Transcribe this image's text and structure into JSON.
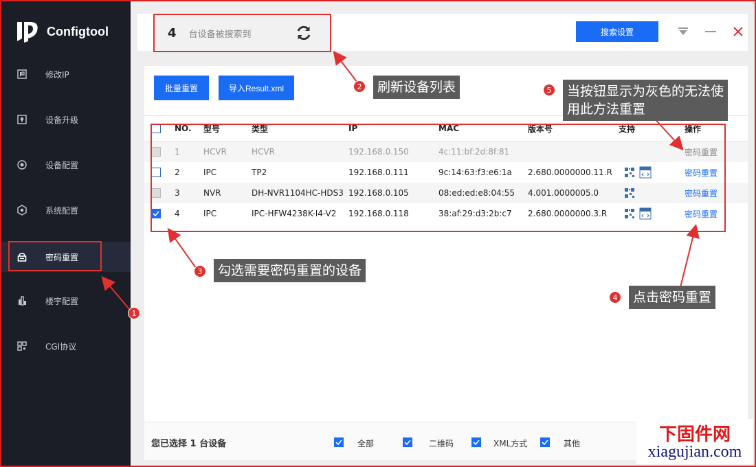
{
  "app": {
    "name": "Configtool"
  },
  "sidebar": {
    "items": [
      {
        "label": "修改IP",
        "icon": "ip-icon"
      },
      {
        "label": "设备升级",
        "icon": "upgrade-icon"
      },
      {
        "label": "设备配置",
        "icon": "config-icon"
      },
      {
        "label": "系统配置",
        "icon": "system-icon"
      },
      {
        "label": "密码重置",
        "icon": "lock-icon",
        "active": true
      },
      {
        "label": "楼宇配置",
        "icon": "building-icon"
      },
      {
        "label": "CGI协议",
        "icon": "cgi-icon"
      }
    ]
  },
  "topbar": {
    "device_count": "4",
    "device_count_label": "台设备被搜索到",
    "search_settings": "搜索设置"
  },
  "toolbar": {
    "batch_reset": "批量重置",
    "import_result": "导入Result.xml"
  },
  "table": {
    "headers": {
      "no": "NO.",
      "model": "型号",
      "type": "类型",
      "ip": "IP",
      "mac": "MAC",
      "version": "版本号",
      "support": "支持",
      "action": "操作"
    },
    "rows": [
      {
        "no": "1",
        "model": "HCVR",
        "type": "HCVR",
        "ip": "192.168.0.150",
        "mac": "4c:11:bf:2d:8f:81",
        "version": "",
        "action": "密码重置",
        "state": "disabled",
        "checked": false,
        "qr": false,
        "xml": false
      },
      {
        "no": "2",
        "model": "IPC",
        "type": "TP2",
        "ip": "192.168.0.111",
        "mac": "9c:14:63:f3:e6:1a",
        "version": "2.680.0000000.11.R",
        "action": "密码重置",
        "state": "normal",
        "checked": false,
        "qr": true,
        "xml": true
      },
      {
        "no": "3",
        "model": "NVR",
        "type": "DH-NVR1104HC-HDS3",
        "ip": "192.168.0.105",
        "mac": "08:ed:ed:e8:04:55",
        "version": "4.001.0000005.0",
        "action": "密码重置",
        "state": "normal",
        "checked": false,
        "qr": true,
        "xml": false
      },
      {
        "no": "4",
        "model": "IPC",
        "type": "IPC-HFW4238K-I4-V2",
        "ip": "192.168.0.118",
        "mac": "38:af:29:d3:2b:c7",
        "version": "2.680.0000000.3.R",
        "action": "密码重置",
        "state": "normal",
        "checked": true,
        "qr": true,
        "xml": true
      }
    ]
  },
  "footer": {
    "selected_prefix": "您已选择",
    "selected_count": "1",
    "selected_suffix": "台设备",
    "filters": [
      "全部",
      "二维码",
      "XML方式",
      "其他"
    ]
  },
  "annotations": [
    {
      "num": "1",
      "text": ""
    },
    {
      "num": "2",
      "text": "刷新设备列表"
    },
    {
      "num": "3",
      "text": "勾选需要密码重置的设备"
    },
    {
      "num": "4",
      "text": "点击密码重置"
    },
    {
      "num": "5",
      "text_line1": "当按钮显示为灰色的无法使",
      "text_line2": "用此方法重置"
    }
  ],
  "watermark": {
    "line1": "下固件网",
    "line2": "xiagujian.com"
  },
  "colors": {
    "accent": "#1a6cf4",
    "sidebar": "#1b1e26",
    "annotation_red": "#e03030"
  }
}
